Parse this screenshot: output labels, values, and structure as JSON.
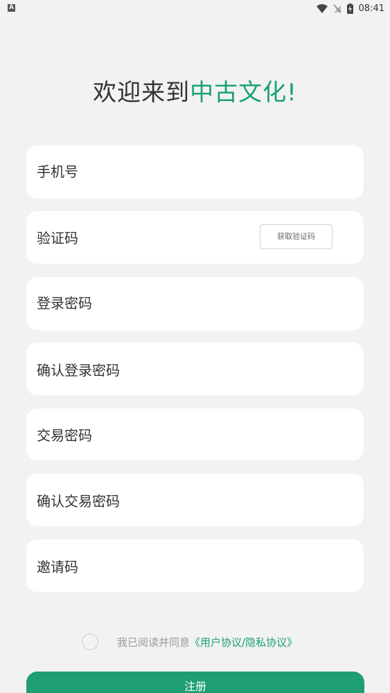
{
  "status_bar": {
    "left_icon_letter": "A",
    "time": "08:41"
  },
  "title": {
    "prefix": "欢迎来到",
    "brand": "中古文化!"
  },
  "fields": {
    "phone": "手机号",
    "code": "验证码",
    "get_code_label": "获取验证码",
    "password": "登录密码",
    "confirm_password": "确认登录密码",
    "trade_password": "交易密码",
    "confirm_trade_password": "确认交易密码",
    "invite_code": "邀请码"
  },
  "agreement": {
    "text": "我已阅读并同意",
    "link": "《用户协议/隐私协议》"
  },
  "register_label": "注册",
  "colors": {
    "accent": "#1aa078",
    "button": "#1f9e75",
    "background": "#f2f2f2"
  }
}
